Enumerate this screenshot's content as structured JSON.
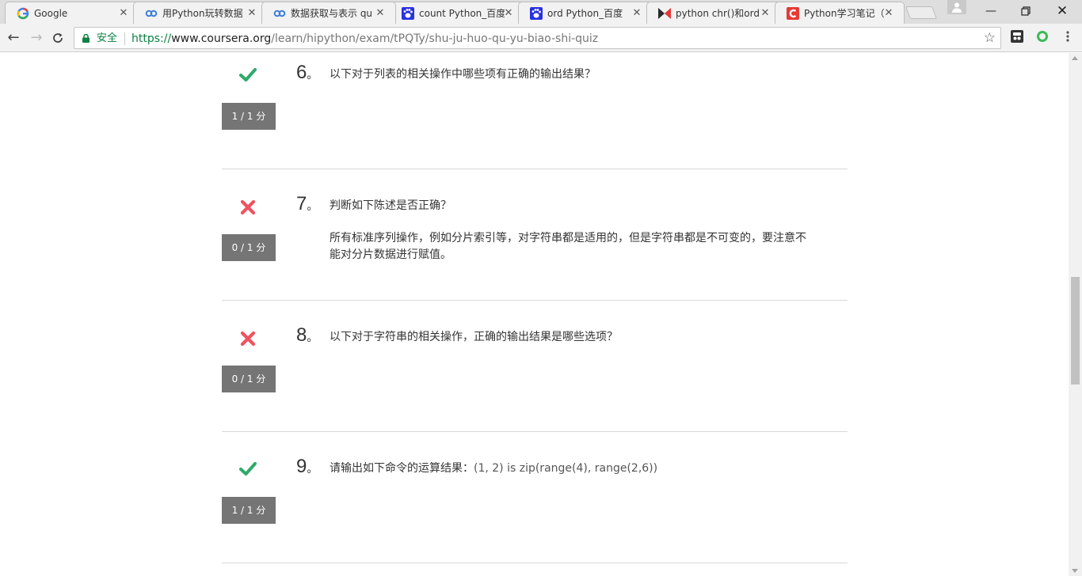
{
  "browser": {
    "tabs": [
      {
        "title": "Google",
        "icon": "google-icon"
      },
      {
        "title": "用Python玩转数据",
        "icon": "coursera-icon"
      },
      {
        "title": "数据获取与表示 qu",
        "icon": "coursera-icon",
        "active": true
      },
      {
        "title": "count Python_百度",
        "icon": "baidu-icon"
      },
      {
        "title": "ord Python_百度",
        "icon": "baidu-icon"
      },
      {
        "title": "python chr()和ord",
        "icon": "runoob-icon"
      },
      {
        "title": "Python学习笔记（",
        "icon": "csdn-icon"
      }
    ],
    "secure_label": "安全",
    "url_scheme": "https://",
    "url_host": "www.coursera.org",
    "url_path": "/learn/hipython/exam/tPQTy/shu-ju-huo-qu-yu-biao-shi-quiz",
    "colors": {
      "secure_green": "#0b8043",
      "correct": "#2eaa6b",
      "wrong": "#f0525f",
      "score_bg": "#757575"
    }
  },
  "questions": [
    {
      "number": "6",
      "punct": "。",
      "text": "以下对于列表的相关操作中哪些项有正确的输出结果？",
      "status": "correct",
      "score": "1 / 1 分"
    },
    {
      "number": "7",
      "punct": "。",
      "text": "判断如下陈述是否正确？",
      "extra_line1": "所有标准序列操作，例如分片索引等，对字符串都是适用的，但是字符串都是不可变的，要注意不",
      "extra_line2": "能对分片数据进行赋值。",
      "status": "wrong",
      "score": "0 / 1 分"
    },
    {
      "number": "8",
      "punct": "。",
      "text": "以下对于字符串的相关操作，正确的输出结果是哪些选项？",
      "status": "wrong",
      "score": "0 / 1 分"
    },
    {
      "number": "9",
      "punct": "。",
      "text": "请输出如下命令的运算结果：",
      "code": "(1, 2) is zip(range(4), range(2,6))",
      "status": "correct",
      "score": "1 / 1 分"
    }
  ]
}
